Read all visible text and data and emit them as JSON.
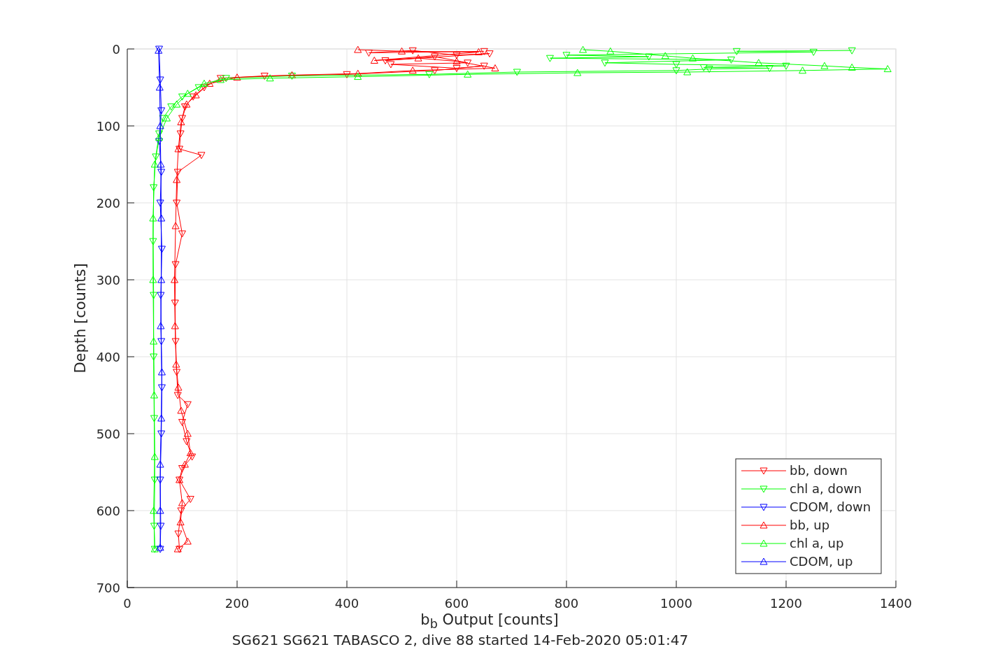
{
  "figure": {
    "chart_data": {
      "type": "line",
      "title": "SG621 SG621 TABASCO 2, dive 88 started 14-Feb-2020 05:01:47",
      "xlabel": "b$_{b}$ Output [counts]",
      "ylabel": "Depth [counts]",
      "xlim": [
        0,
        1400
      ],
      "ylim": [
        700,
        0
      ],
      "xticks": [
        0,
        200,
        400,
        600,
        800,
        1000,
        1200,
        1400
      ],
      "yticks": [
        0,
        100,
        200,
        300,
        400,
        500,
        600,
        700
      ],
      "grid": true,
      "legend": "lower right",
      "series": [
        {
          "name": "bb, down",
          "color": "#ff0000",
          "marker": "triangle",
          "x": [
            650,
            440,
            520,
            600,
            660,
            470,
            560,
            620,
            480,
            600,
            650,
            560,
            400,
            250,
            170,
            140,
            120,
            105,
            100,
            97,
            95,
            135,
            92,
            90,
            100,
            88,
            87,
            88,
            90,
            92,
            110,
            100,
            108,
            118,
            100,
            95,
            115,
            98,
            93,
            95
          ],
          "values": [
            3,
            5,
            2,
            8,
            6,
            15,
            10,
            18,
            20,
            25,
            22,
            28,
            33,
            35,
            38,
            50,
            62,
            75,
            90,
            110,
            130,
            138,
            160,
            200,
            240,
            280,
            330,
            380,
            420,
            450,
            462,
            485,
            510,
            530,
            545,
            560,
            585,
            600,
            630,
            650
          ]
        },
        {
          "name": "chl a, down",
          "color": "#00ff00",
          "marker": "triangle",
          "x": [
            1320,
            1110,
            1250,
            800,
            950,
            770,
            1100,
            870,
            1000,
            1200,
            1050,
            1170,
            1060,
            1000,
            710,
            550,
            300,
            180,
            130,
            100,
            80,
            65,
            58,
            52,
            48,
            47,
            48,
            48,
            49,
            50,
            49,
            50
          ],
          "values": [
            2,
            3,
            4,
            8,
            10,
            12,
            14,
            18,
            20,
            22,
            24,
            25,
            26,
            28,
            30,
            33,
            35,
            38,
            50,
            62,
            75,
            90,
            110,
            140,
            180,
            250,
            320,
            400,
            480,
            560,
            620,
            650
          ]
        },
        {
          "name": "CDOM, down",
          "color": "#0000ff",
          "marker": "triangle",
          "x": [
            58,
            60,
            62,
            58,
            62,
            60,
            63,
            61,
            62,
            63,
            62,
            60,
            61,
            60
          ],
          "values": [
            0,
            40,
            80,
            120,
            160,
            200,
            260,
            320,
            380,
            440,
            500,
            560,
            620,
            650
          ]
        },
        {
          "name": "bb, up",
          "color": "#ff0000",
          "marker": "triangle",
          "x": [
            420,
            500,
            640,
            450,
            530,
            600,
            670,
            520,
            420,
            300,
            200,
            150,
            125,
            108,
            98,
            93,
            90,
            88,
            86,
            87,
            89,
            93,
            98,
            110,
            115,
            105,
            95,
            100,
            97,
            110,
            92
          ],
          "values": [
            1,
            3,
            4,
            15,
            12,
            16,
            25,
            28,
            32,
            34,
            37,
            45,
            60,
            72,
            95,
            130,
            170,
            230,
            300,
            360,
            410,
            440,
            470,
            500,
            525,
            540,
            560,
            590,
            615,
            640,
            650
          ]
        },
        {
          "name": "chl a, up",
          "color": "#00ff00",
          "marker": "triangle",
          "x": [
            830,
            880,
            980,
            1030,
            1150,
            1270,
            1320,
            1385,
            1230,
            1020,
            820,
            620,
            420,
            260,
            170,
            140,
            110,
            90,
            72,
            58,
            50,
            47,
            47,
            48,
            49,
            50,
            48,
            50
          ],
          "values": [
            1,
            3,
            9,
            12,
            18,
            22,
            24,
            26,
            28,
            30,
            31,
            33,
            36,
            38,
            40,
            45,
            58,
            72,
            90,
            115,
            150,
            220,
            300,
            380,
            450,
            530,
            600,
            650
          ]
        },
        {
          "name": "CDOM, up",
          "color": "#0000ff",
          "marker": "triangle",
          "x": [
            57,
            59,
            60,
            61,
            62,
            62,
            61,
            63,
            62,
            60,
            60,
            60
          ],
          "values": [
            2,
            50,
            100,
            150,
            220,
            300,
            360,
            420,
            480,
            540,
            600,
            648
          ]
        }
      ]
    }
  }
}
